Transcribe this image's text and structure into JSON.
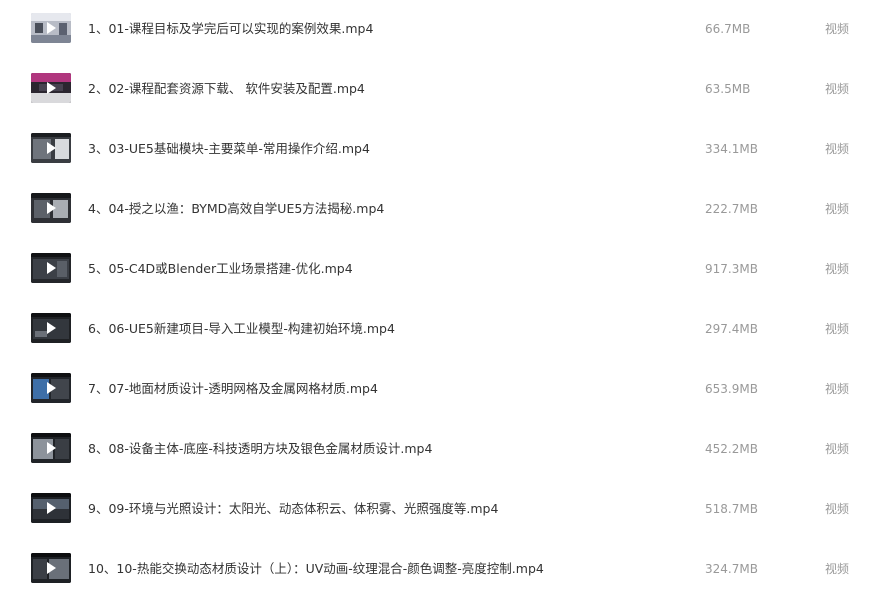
{
  "files": [
    {
      "name": "1、01-课程目标及学完后可以实现的案例效果.mp4",
      "size": "66.7MB",
      "type": "视频",
      "thumb": "light",
      "icon": "video-play-icon"
    },
    {
      "name": "2、02-课程配套资源下载、 软件安装及配置.mp4",
      "size": "63.5MB",
      "type": "视频",
      "thumb": "magenta",
      "icon": "video-play-icon"
    },
    {
      "name": "3、03-UE5基础模块-主要菜单-常用操作介绍.mp4",
      "size": "334.1MB",
      "type": "视频",
      "thumb": "gray",
      "icon": "video-play-icon"
    },
    {
      "name": "4、04-授之以渔：BYMD高效自学UE5方法揭秘.mp4",
      "size": "222.7MB",
      "type": "视频",
      "thumb": "gray",
      "icon": "video-play-icon"
    },
    {
      "name": "5、05-C4D或Blender工业场景搭建-优化.mp4",
      "size": "917.3MB",
      "type": "视频",
      "thumb": "dark",
      "icon": "video-play-icon"
    },
    {
      "name": "6、06-UE5新建项目-导入工业模型-构建初始环境.mp4",
      "size": "297.4MB",
      "type": "视频",
      "thumb": "dark",
      "icon": "video-play-icon"
    },
    {
      "name": "7、07-地面材质设计-透明网格及金属网格材质.mp4",
      "size": "653.9MB",
      "type": "视频",
      "thumb": "dark",
      "icon": "video-play-icon"
    },
    {
      "name": "8、08-设备主体-底座-科技透明方块及银色金属材质设计.mp4",
      "size": "452.2MB",
      "type": "视频",
      "thumb": "dark",
      "icon": "video-play-icon"
    },
    {
      "name": "9、09-环境与光照设计：太阳光、动态体积云、体积雾、光照强度等.mp4",
      "size": "518.7MB",
      "type": "视频",
      "thumb": "dark",
      "icon": "video-play-icon"
    },
    {
      "name": "10、10-热能交换动态材质设计（上）：UV动画-纹理混合-颜色调整-亮度控制.mp4",
      "size": "324.7MB",
      "type": "视频",
      "thumb": "dark",
      "icon": "video-play-icon"
    }
  ],
  "colors": {
    "name_text": "#333333",
    "meta_text": "#999999",
    "background": "#ffffff"
  }
}
